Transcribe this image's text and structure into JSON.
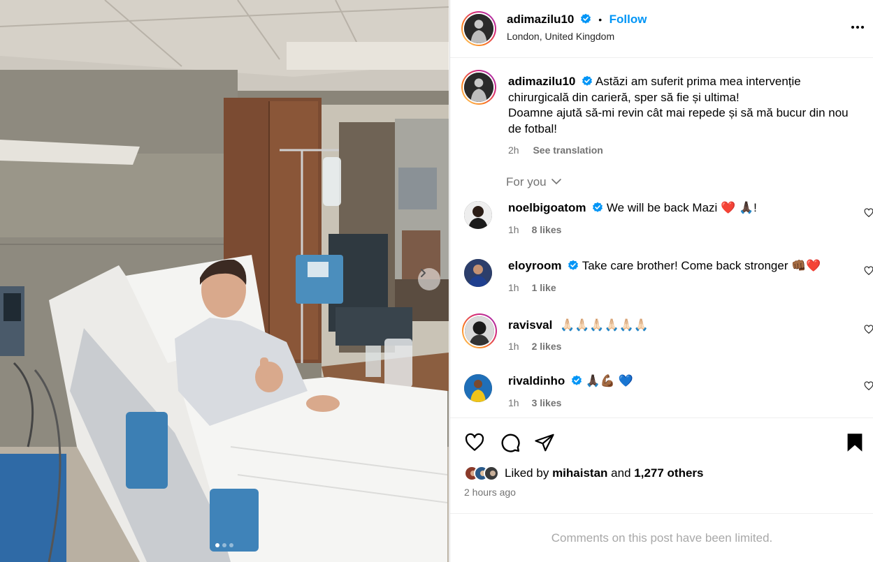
{
  "post": {
    "author": "adimazilu10",
    "location": "London, United Kingdom",
    "follow_label": "Follow",
    "separator": "•",
    "caption_line1": "Astăzi am suferit prima mea intervenție chirurgicală din carieră, sper să fie și ultima!",
    "caption_line2": "Doamne ajută să-mi revin cât mai repede și să mă bucur din nou de fotbal!",
    "caption_time": "2h",
    "see_translation": "See translation",
    "carousel_slide_current": 1,
    "carousel_slide_total": 3
  },
  "for_you_label": "For you",
  "comments": [
    {
      "user": "noelbigoatom",
      "verified": true,
      "text": "We will be back Mazi ❤️ 🙏🏿!",
      "time": "1h",
      "likes": "8 likes"
    },
    {
      "user": "eloyroom",
      "verified": true,
      "text": "Take care brother! Come back stronger 👊🏾❤️",
      "time": "1h",
      "likes": "1 like"
    },
    {
      "user": "ravisval",
      "verified": false,
      "text": "🙏🏻🙏🏻🙏🏻🙏🏻🙏🏻🙏🏻",
      "time": "1h",
      "likes": "2 likes"
    },
    {
      "user": "rivaldinho",
      "verified": true,
      "text": "🙏🏿💪🏾 💙",
      "time": "1h",
      "likes": "3 likes"
    }
  ],
  "likes": {
    "prefix": "Liked by",
    "user": "mihaistan",
    "middle": "and",
    "others": "1,277 others"
  },
  "time_ago": "2 hours ago",
  "comments_limited": "Comments on this post have been limited.",
  "colors": {
    "link_blue": "#0095f6",
    "verified_blue": "#0095f6",
    "secondary_text": "#737373",
    "muted_text": "#a8a8a8",
    "border": "#dbdbdb"
  },
  "icons": [
    "more-options-icon",
    "verified-badge-icon",
    "chevron-down-icon",
    "heart-icon",
    "comment-icon",
    "share-icon",
    "bookmark-icon",
    "next-slide-icon"
  ]
}
